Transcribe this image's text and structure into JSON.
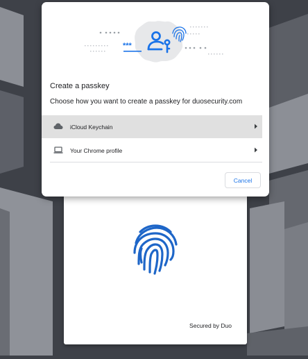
{
  "dialog": {
    "title": "Create a passkey",
    "subtitle": "Choose how you want to create a passkey for duosecurity.com",
    "options": [
      {
        "label": "iCloud Keychain",
        "icon": "cloud-icon"
      },
      {
        "label": "Your Chrome profile",
        "icon": "laptop-icon"
      }
    ],
    "cancel_label": "Cancel",
    "illustration_password_text": "***"
  },
  "card": {
    "footer": "Secured by Duo",
    "icon": "fingerprint-icon"
  },
  "colors": {
    "background": "#3e4148",
    "accent": "#1a73e8",
    "fingerprint_blue": "#1e66c8",
    "highlight": "#e0e0e0"
  }
}
